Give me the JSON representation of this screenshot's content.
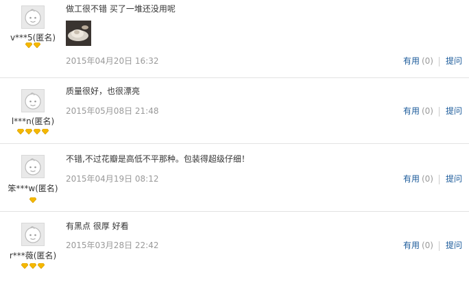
{
  "reviews": [
    {
      "username": "v***5(匿名)",
      "level": 2,
      "content": "做工很不错 买了一堆还没用呢",
      "has_photo": true,
      "date": "2015年04月20日 16:32",
      "useful_label": "有用",
      "useful_count": "(0)",
      "ask_label": "提问"
    },
    {
      "username": "l***n(匿名)",
      "level": 4,
      "content": "质量很好，也很漂亮",
      "has_photo": false,
      "date": "2015年05月08日 21:48",
      "useful_label": "有用",
      "useful_count": "(0)",
      "ask_label": "提问"
    },
    {
      "username": "笨***w(匿名)",
      "level": 1,
      "content": "不错,不过花瓣是高低不平那种。包装得超级仔细！",
      "has_photo": false,
      "date": "2015年04月19日 08:12",
      "useful_label": "有用",
      "useful_count": "(0)",
      "ask_label": "提问"
    },
    {
      "username": "r***薇(匿名)",
      "level": 3,
      "content": "有黑点 很厚 好看",
      "has_photo": false,
      "date": "2015年03月28日 22:42",
      "useful_label": "有用",
      "useful_count": "(0)",
      "ask_label": "提问"
    }
  ],
  "colors": {
    "link": "#1a5a9a",
    "date": "#999999",
    "gem": "#f5b800",
    "divider": "#e2e2e2"
  }
}
